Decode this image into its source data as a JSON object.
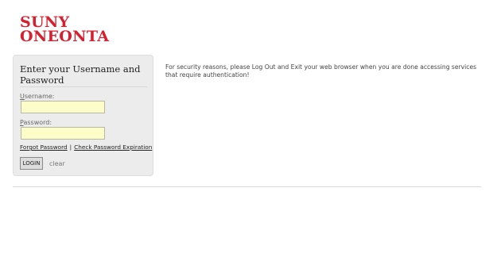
{
  "brand": {
    "line1": "SUNY",
    "line2": "ONEONTA",
    "color": "#d6202f"
  },
  "login": {
    "title": "Enter your Username and Password",
    "username_label_ul": "U",
    "username_label_rest": "sername:",
    "username_value": "",
    "password_label_ul": "P",
    "password_label_rest": "assword:",
    "password_value": "",
    "forgot_password": "Forgot Password",
    "separator": "|",
    "check_expiration": "Check Password Expiration",
    "login_button": "LOGIN",
    "clear_link": "clear"
  },
  "notice": {
    "text": "For security reasons, please Log Out and Exit your web browser when you are done accessing services that require authentication!"
  },
  "colors": {
    "input_background": "#fdfdc9",
    "panel_background": "#ececec"
  }
}
